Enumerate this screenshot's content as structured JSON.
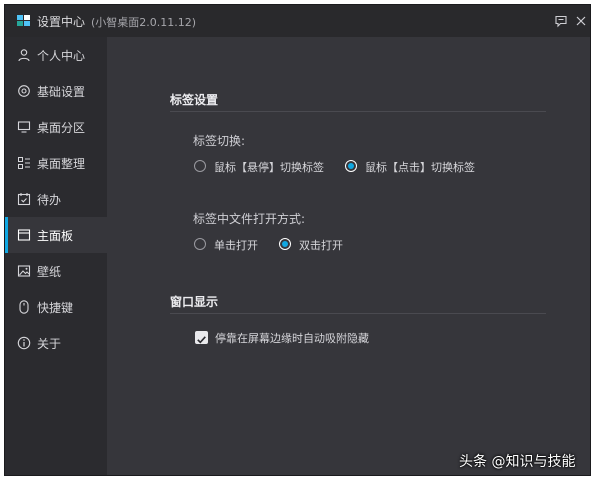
{
  "window": {
    "title": "设置中心",
    "version": "(小智桌面2.0.11.12)",
    "logo_colors": [
      "#4fc3f7",
      "#26a69a",
      "#ffffff"
    ]
  },
  "titlebar_icons": {
    "feedback": "message-icon",
    "close": "close-icon"
  },
  "sidebar": {
    "accent_color": "#11a8e2",
    "items": [
      {
        "label": "个人中心",
        "icon": "user-icon"
      },
      {
        "label": "基础设置",
        "icon": "gear-icon"
      },
      {
        "label": "桌面分区",
        "icon": "monitor-icon"
      },
      {
        "label": "桌面整理",
        "icon": "organize-icon"
      },
      {
        "label": "待办",
        "icon": "calendar-check-icon"
      },
      {
        "label": "主面板",
        "icon": "panel-icon",
        "active": true
      },
      {
        "label": "壁纸",
        "icon": "image-icon"
      },
      {
        "label": "快捷键",
        "icon": "mouse-icon"
      },
      {
        "label": "关于",
        "icon": "info-icon"
      }
    ]
  },
  "main": {
    "tab_settings": {
      "title": "标签设置",
      "switch_label": "标签切换:",
      "switch_options": [
        {
          "label": "鼠标【悬停】切换标签",
          "checked": false
        },
        {
          "label": "鼠标【点击】切换标签",
          "checked": true
        }
      ],
      "open_label": "标签中文件打开方式:",
      "open_options": [
        {
          "label": "单击打开",
          "checked": false
        },
        {
          "label": "双击打开",
          "checked": true
        }
      ]
    },
    "window_display": {
      "title": "窗口显示",
      "checkbox_label": "停靠在屏幕边缘时自动吸附隐藏",
      "checked": true
    }
  },
  "watermark": "头条 @知识与技能"
}
